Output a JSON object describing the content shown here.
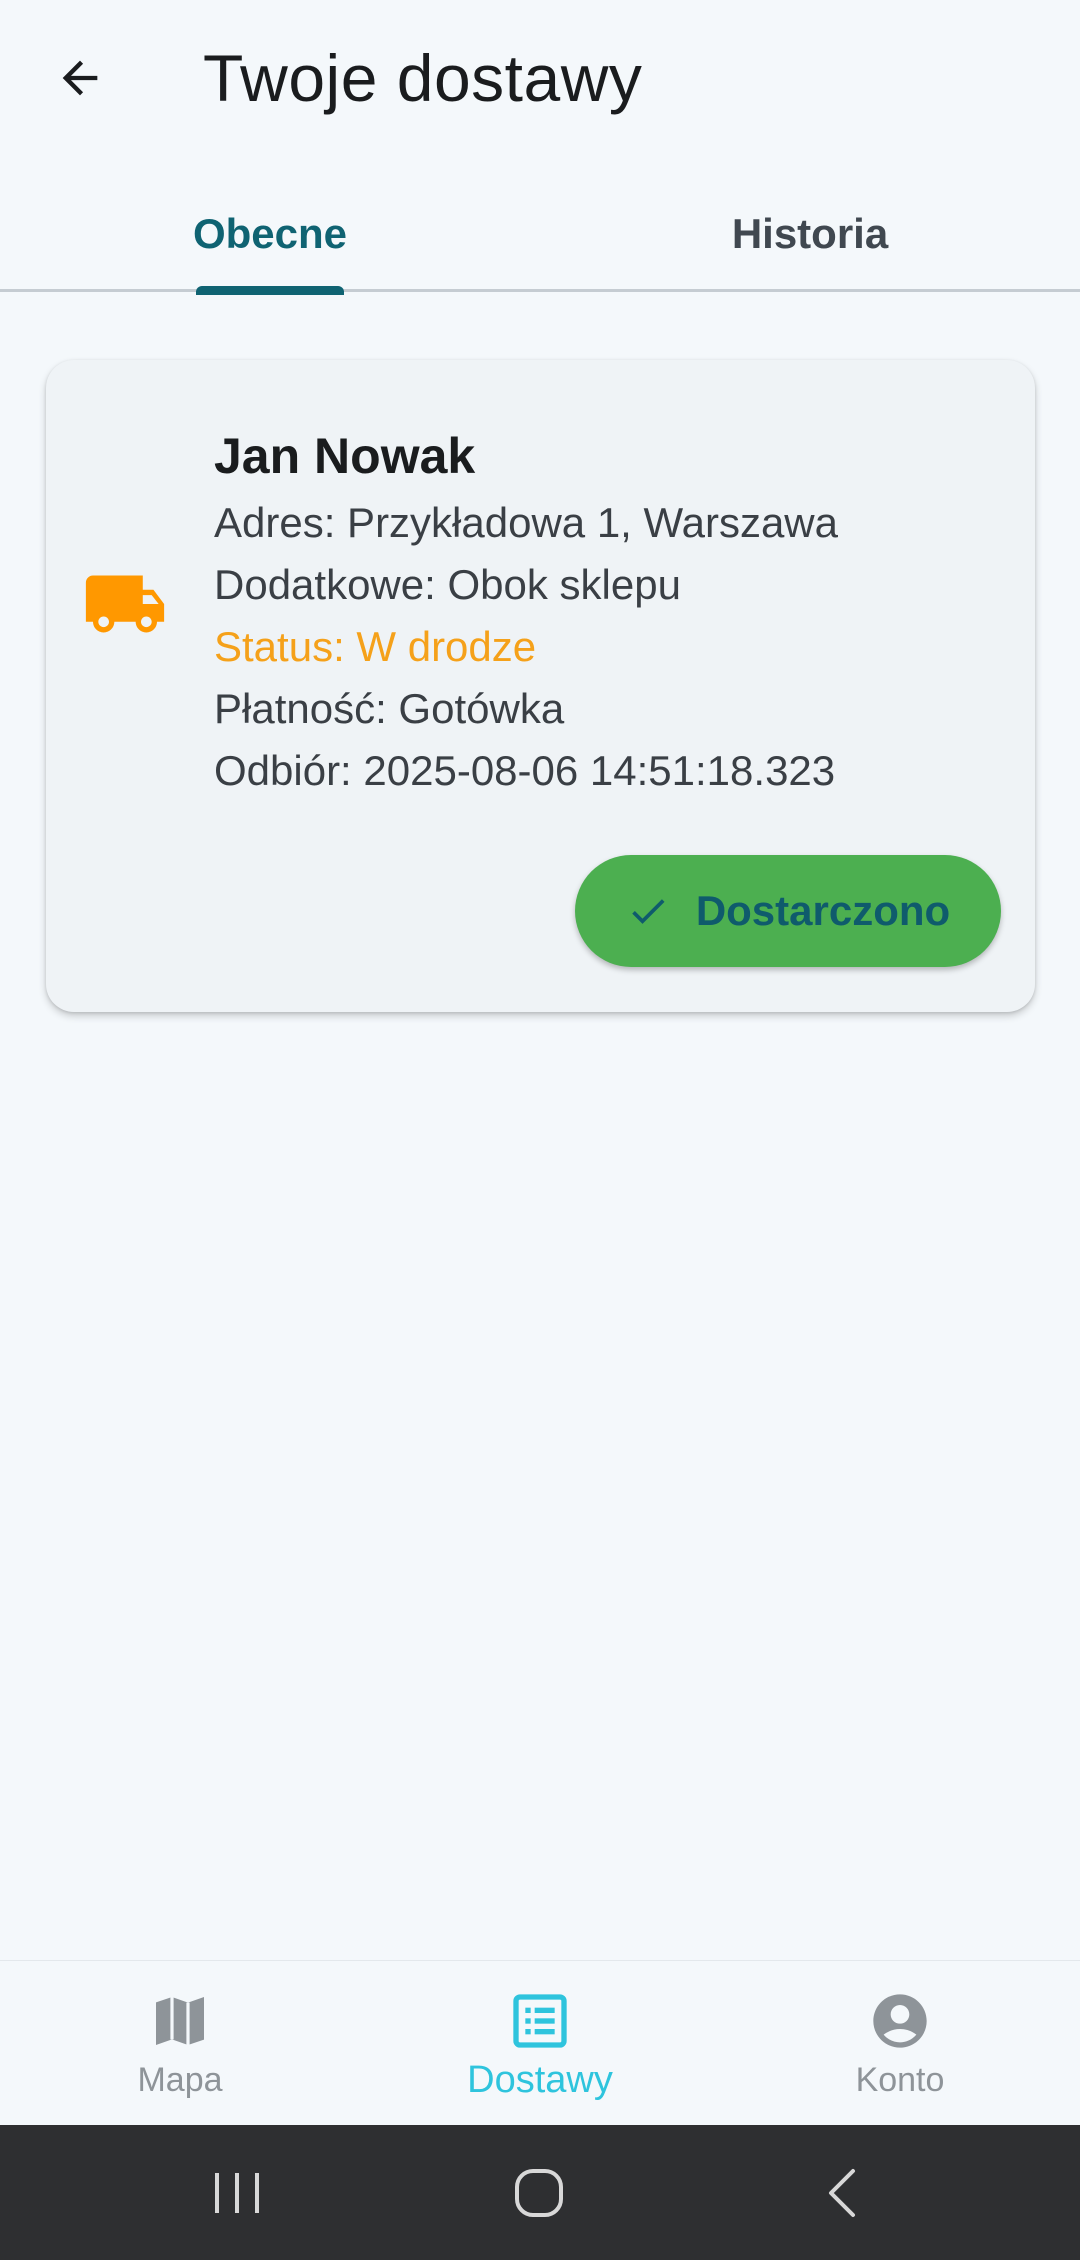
{
  "header": {
    "title": "Twoje dostawy",
    "back_icon": "arrow-back-icon"
  },
  "tabs": [
    {
      "label": "Obecne",
      "active": true
    },
    {
      "label": "Historia",
      "active": false
    }
  ],
  "delivery": {
    "icon": "truck-icon",
    "icon_color": "#ff9800",
    "name": "Jan Nowak",
    "address": "Adres: Przykładowa 1, Warszawa",
    "extra": "Dodatkowe: Obok sklepu",
    "status": "Status: W drodze",
    "status_color": "#f5a11a",
    "payment": "Płatność: Gotówka",
    "pickup": "Odbiór: 2025-08-06 14:51:18.323",
    "action_label": "Dostarczono",
    "action_icon": "check-icon",
    "action_color": "#4caf50"
  },
  "bottom_nav": [
    {
      "label": "Mapa",
      "icon": "map-icon",
      "active": false
    },
    {
      "label": "Dostawy",
      "icon": "list-icon",
      "active": true
    },
    {
      "label": "Konto",
      "icon": "account-circle-icon",
      "active": false
    }
  ],
  "system_nav": {
    "recents_icon": "recents-icon",
    "home_icon": "home-icon",
    "back_icon": "system-back-icon"
  },
  "colors": {
    "accent": "#0f6372",
    "nav_active": "#2ec4dd",
    "background": "#f4f8fb"
  }
}
